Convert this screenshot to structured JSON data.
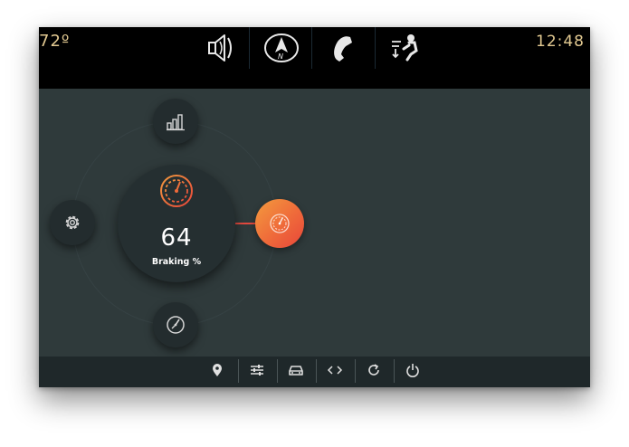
{
  "status": {
    "temperature": "72º",
    "clock": "12:48"
  },
  "top_nav": [
    {
      "icon": "speaker-icon"
    },
    {
      "icon": "navigation-compass-icon",
      "letter": "N"
    },
    {
      "icon": "phone-icon"
    },
    {
      "icon": "climate-fan-icon"
    }
  ],
  "dial": {
    "value": "64",
    "label": "Braking %",
    "icon": "gauge-icon",
    "nodes": [
      {
        "icon": "bar-chart-icon",
        "position": "top"
      },
      {
        "icon": "settings-gear-icon",
        "position": "left"
      },
      {
        "icon": "clock-dial-icon",
        "position": "bottom"
      },
      {
        "icon": "gauge-icon",
        "position": "right",
        "active": true
      }
    ]
  },
  "bottom_nav": [
    {
      "icon": "location-pin-icon"
    },
    {
      "icon": "sliders-icon"
    },
    {
      "icon": "car-icon"
    },
    {
      "icon": "code-arrows-icon"
    },
    {
      "icon": "refresh-icon"
    },
    {
      "icon": "power-icon"
    }
  ],
  "colors": {
    "background": "#2f3a3b",
    "bars": "#000000",
    "status_text": "#e2c991",
    "accent_start": "#f39b3e",
    "accent_end": "#e8463a",
    "hub": "#252f31"
  }
}
